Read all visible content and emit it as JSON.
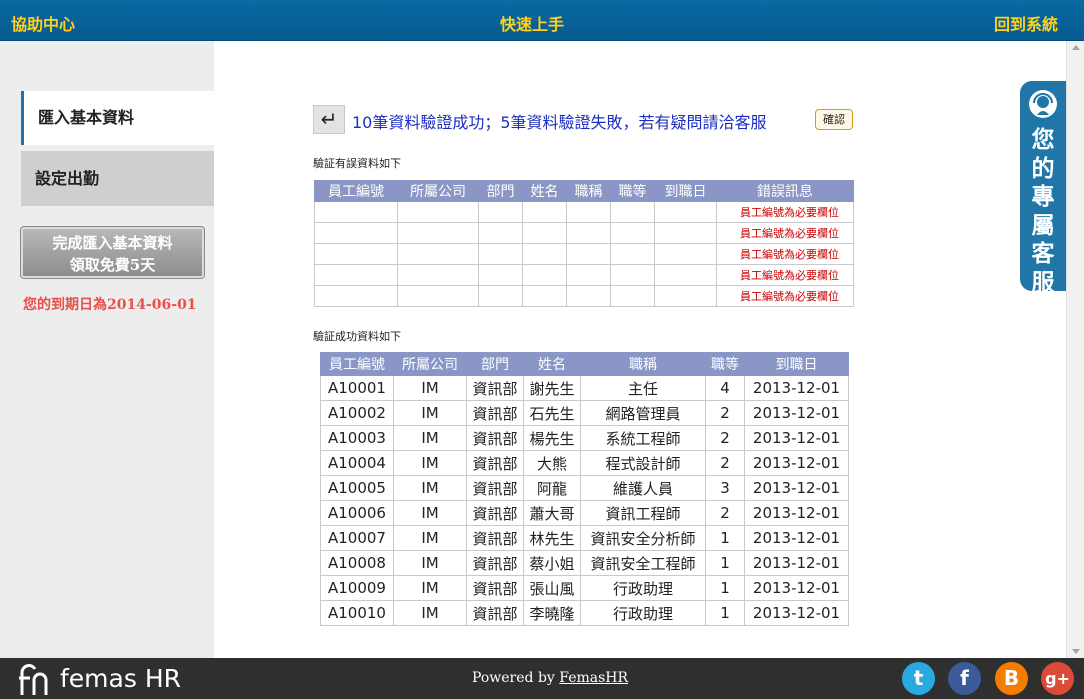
{
  "topbar": {
    "help_center": "協助中心",
    "quick_start": "快速上手",
    "back_to_system": "回到系統"
  },
  "sidebar": {
    "items": [
      {
        "label": "匯入基本資料",
        "active": true
      },
      {
        "label": "設定出勤",
        "active": false
      }
    ],
    "complete_button_line1": "完成匯入基本資料",
    "complete_button_line2": "領取免費5天",
    "expiry_text": "您的到期日為2014-06-01"
  },
  "main": {
    "back_icon": "back-arrow-icon",
    "message": "10筆資料驗證成功；5筆資料驗證失敗，若有疑問請洽客服",
    "confirm_label": "確認",
    "error_section_label": "驗証有誤資料如下",
    "success_section_label": "驗証成功資料如下",
    "error_table": {
      "headers": [
        "員工編號",
        "所屬公司",
        "部門",
        "姓名",
        "職稱",
        "職等",
        "到職日",
        "錯誤訊息"
      ],
      "rows": [
        [
          "",
          "",
          "",
          "",
          "",
          "",
          "",
          "員工編號為必要欄位"
        ],
        [
          "",
          "",
          "",
          "",
          "",
          "",
          "",
          "員工編號為必要欄位"
        ],
        [
          "",
          "",
          "",
          "",
          "",
          "",
          "",
          "員工編號為必要欄位"
        ],
        [
          "",
          "",
          "",
          "",
          "",
          "",
          "",
          "員工編號為必要欄位"
        ],
        [
          "",
          "",
          "",
          "",
          "",
          "",
          "",
          "員工編號為必要欄位"
        ]
      ]
    },
    "success_table": {
      "headers": [
        "員工編號",
        "所屬公司",
        "部門",
        "姓名",
        "職稱",
        "職等",
        "到職日"
      ],
      "rows": [
        [
          "A10001",
          "IM",
          "資訊部",
          "謝先生",
          "主任",
          "4",
          "2013-12-01"
        ],
        [
          "A10002",
          "IM",
          "資訊部",
          "石先生",
          "網路管理員",
          "2",
          "2013-12-01"
        ],
        [
          "A10003",
          "IM",
          "資訊部",
          "楊先生",
          "系統工程師",
          "2",
          "2013-12-01"
        ],
        [
          "A10004",
          "IM",
          "資訊部",
          "大熊",
          "程式設計師",
          "2",
          "2013-12-01"
        ],
        [
          "A10005",
          "IM",
          "資訊部",
          "阿龍",
          "維護人員",
          "3",
          "2013-12-01"
        ],
        [
          "A10006",
          "IM",
          "資訊部",
          "蕭大哥",
          "資訊工程師",
          "2",
          "2013-12-01"
        ],
        [
          "A10007",
          "IM",
          "資訊部",
          "林先生",
          "資訊安全分析師",
          "1",
          "2013-12-01"
        ],
        [
          "A10008",
          "IM",
          "資訊部",
          "蔡小姐",
          "資訊安全工程師",
          "1",
          "2013-12-01"
        ],
        [
          "A10009",
          "IM",
          "資訊部",
          "張山風",
          "行政助理",
          "1",
          "2013-12-01"
        ],
        [
          "A10010",
          "IM",
          "資訊部",
          "李曉隆",
          "行政助理",
          "1",
          "2013-12-01"
        ]
      ]
    }
  },
  "service_tab": {
    "icon": "headset-icon",
    "text": "您\n的\n專\n屬\n客\n服"
  },
  "footer": {
    "logo_text": "femas HR",
    "powered_by": "Powered by ",
    "powered_link": "FemasHR",
    "social": [
      {
        "icon": "twitter-icon",
        "glyph": "t"
      },
      {
        "icon": "facebook-icon",
        "glyph": "f"
      },
      {
        "icon": "blogger-icon",
        "glyph": "B"
      },
      {
        "icon": "google-plus-icon",
        "glyph": "g+"
      }
    ]
  },
  "colors": {
    "topbar": "#0a6aa3",
    "topbar_text": "#ffd11a",
    "table_header": "#8a97c6",
    "error_text": "#cc0000",
    "message_text": "#1b2ec0",
    "expiry_text": "#e8504a",
    "footer": "#2f2f2f"
  }
}
